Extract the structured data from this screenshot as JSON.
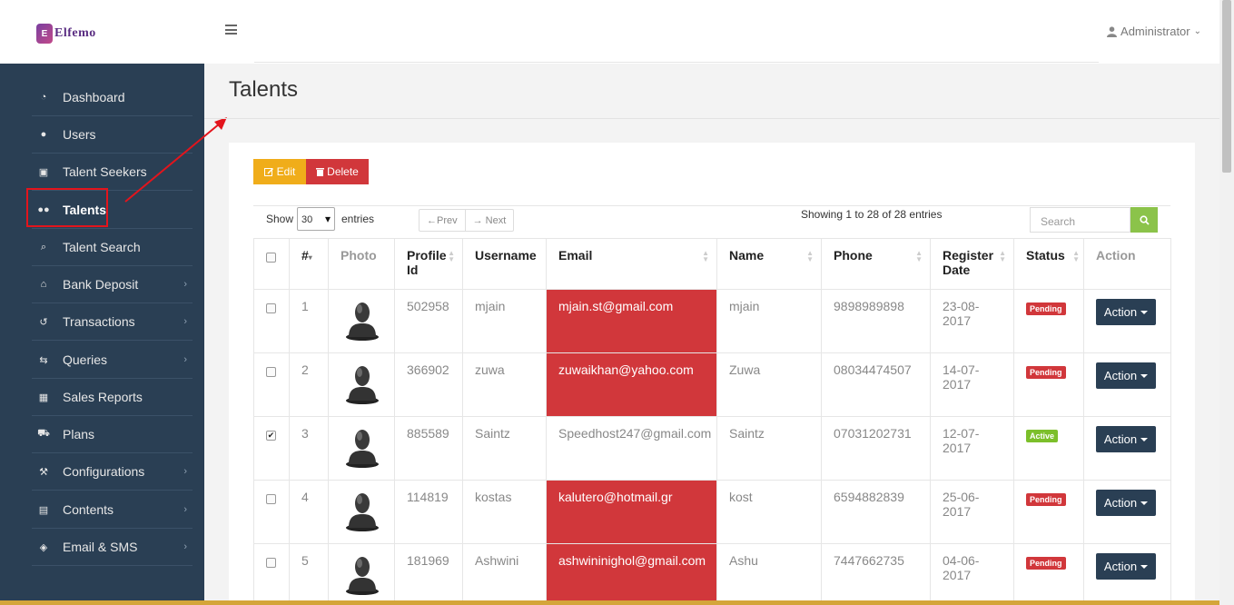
{
  "brand": {
    "name": "Elfemo",
    "mark": "E"
  },
  "header": {
    "user": "Administrator"
  },
  "sidebar": {
    "items": [
      {
        "label": "Dashboard",
        "icon": "dashboard-icon",
        "glyph": "◔",
        "chevron": false
      },
      {
        "label": "Users",
        "icon": "user-icon",
        "glyph": "●",
        "chevron": false
      },
      {
        "label": "Talent Seekers",
        "icon": "briefcase-icon",
        "glyph": "▣",
        "chevron": false
      },
      {
        "label": "Talents",
        "icon": "users-icon",
        "glyph": "●●",
        "chevron": false
      },
      {
        "label": "Talent Search",
        "icon": "search-icon",
        "glyph": "⌕",
        "chevron": false
      },
      {
        "label": "Bank Deposit",
        "icon": "bank-icon",
        "glyph": "⌂",
        "chevron": true
      },
      {
        "label": "Transactions",
        "icon": "history-icon",
        "glyph": "↺",
        "chevron": true
      },
      {
        "label": "Queries",
        "icon": "retweet-icon",
        "glyph": "⇆",
        "chevron": true
      },
      {
        "label": "Sales Reports",
        "icon": "table-icon",
        "glyph": "▦",
        "chevron": false
      },
      {
        "label": "Plans",
        "icon": "cart-icon",
        "glyph": "⛟",
        "chevron": false
      },
      {
        "label": "Configurations",
        "icon": "wrench-icon",
        "glyph": "⚒",
        "chevron": true
      },
      {
        "label": "Contents",
        "icon": "newspaper-icon",
        "glyph": "▤",
        "chevron": true
      },
      {
        "label": "Email & SMS",
        "icon": "shield-icon",
        "glyph": "◈",
        "chevron": true
      }
    ]
  },
  "main": {
    "title": "Talents",
    "edit_label": "Edit",
    "delete_label": "Delete",
    "show_label": "Show",
    "entries_value": "30",
    "entries_label": "entries",
    "prev_label": "←Prev",
    "next_label": "→ Next",
    "showing": "Showing 1 to 28 of 28 entries",
    "search_placeholder": "Search"
  },
  "table": {
    "headers": [
      "#",
      "Photo",
      "Profile Id",
      "Username",
      "Email",
      "Name",
      "Phone",
      "Register Date",
      "Status",
      "Action"
    ],
    "rows": [
      {
        "num": "1",
        "profile_id": "502958",
        "username": "mjain",
        "email": "mjain.st@gmail.com",
        "email_flag": true,
        "name": "mjain",
        "phone": "9898989898",
        "date": "23-08-2017",
        "status": "Pending",
        "checked": false,
        "action": "Action"
      },
      {
        "num": "2",
        "profile_id": "366902",
        "username": "zuwa",
        "email": "zuwaikhan@yahoo.com",
        "email_flag": true,
        "name": "Zuwa",
        "phone": "08034474507",
        "date": "14-07-2017",
        "status": "Pending",
        "checked": false,
        "action": "Action"
      },
      {
        "num": "3",
        "profile_id": "885589",
        "username": "Saintz",
        "email": "Speedhost247@gmail.com",
        "email_flag": false,
        "name": "Saintz",
        "phone": "07031202731",
        "date": "12-07-2017",
        "status": "Active",
        "checked": true,
        "action": "Action"
      },
      {
        "num": "4",
        "profile_id": "114819",
        "username": "kostas",
        "email": "kalutero@hotmail.gr",
        "email_flag": true,
        "name": "kost",
        "phone": "6594882839",
        "date": "25-06-2017",
        "status": "Pending",
        "checked": false,
        "action": "Action"
      },
      {
        "num": "5",
        "profile_id": "181969",
        "username": "Ashwini",
        "email": "ashwininighol@gmail.com",
        "email_flag": true,
        "name": "Ashu",
        "phone": "7447662735",
        "date": "04-06-2017",
        "status": "Pending",
        "checked": false,
        "action": "Action"
      }
    ]
  },
  "colors": {
    "sidebar": "#2a3f54",
    "danger": "#d1373b",
    "warning": "#f0ad1a",
    "success": "#7cbf2a"
  }
}
